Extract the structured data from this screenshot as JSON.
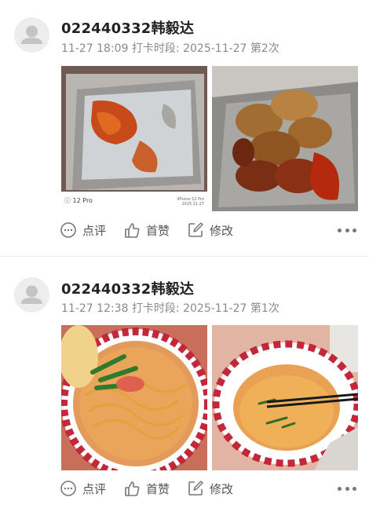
{
  "posts": [
    {
      "name": "022440332韩毅达",
      "time": "11-27 18:09",
      "period_label": "打卡时段: 2025-11-27 第2次",
      "photo_captions": {
        "left": "ⓘ 12 Pro",
        "right_line1": "iPhone 12 Pro",
        "right_line2": "2025.11.27"
      },
      "actions": {
        "comment": "点评",
        "like": "首赞",
        "edit": "修改"
      }
    },
    {
      "name": "022440332韩毅达",
      "time": "11-27 12:38",
      "period_label": "打卡时段: 2025-11-27 第1次",
      "actions": {
        "comment": "点评",
        "like": "首赞",
        "edit": "修改"
      }
    }
  ],
  "icons": {
    "avatar": "default-avatar-icon",
    "comment": "chat-bubble-icon",
    "like": "thumbs-up-icon",
    "edit": "edit-pencil-icon",
    "more": "more-dots-icon"
  },
  "colors": {
    "background": "#ffffff",
    "name": "#222222",
    "meta": "#8a8a8a",
    "action": "#555555"
  }
}
